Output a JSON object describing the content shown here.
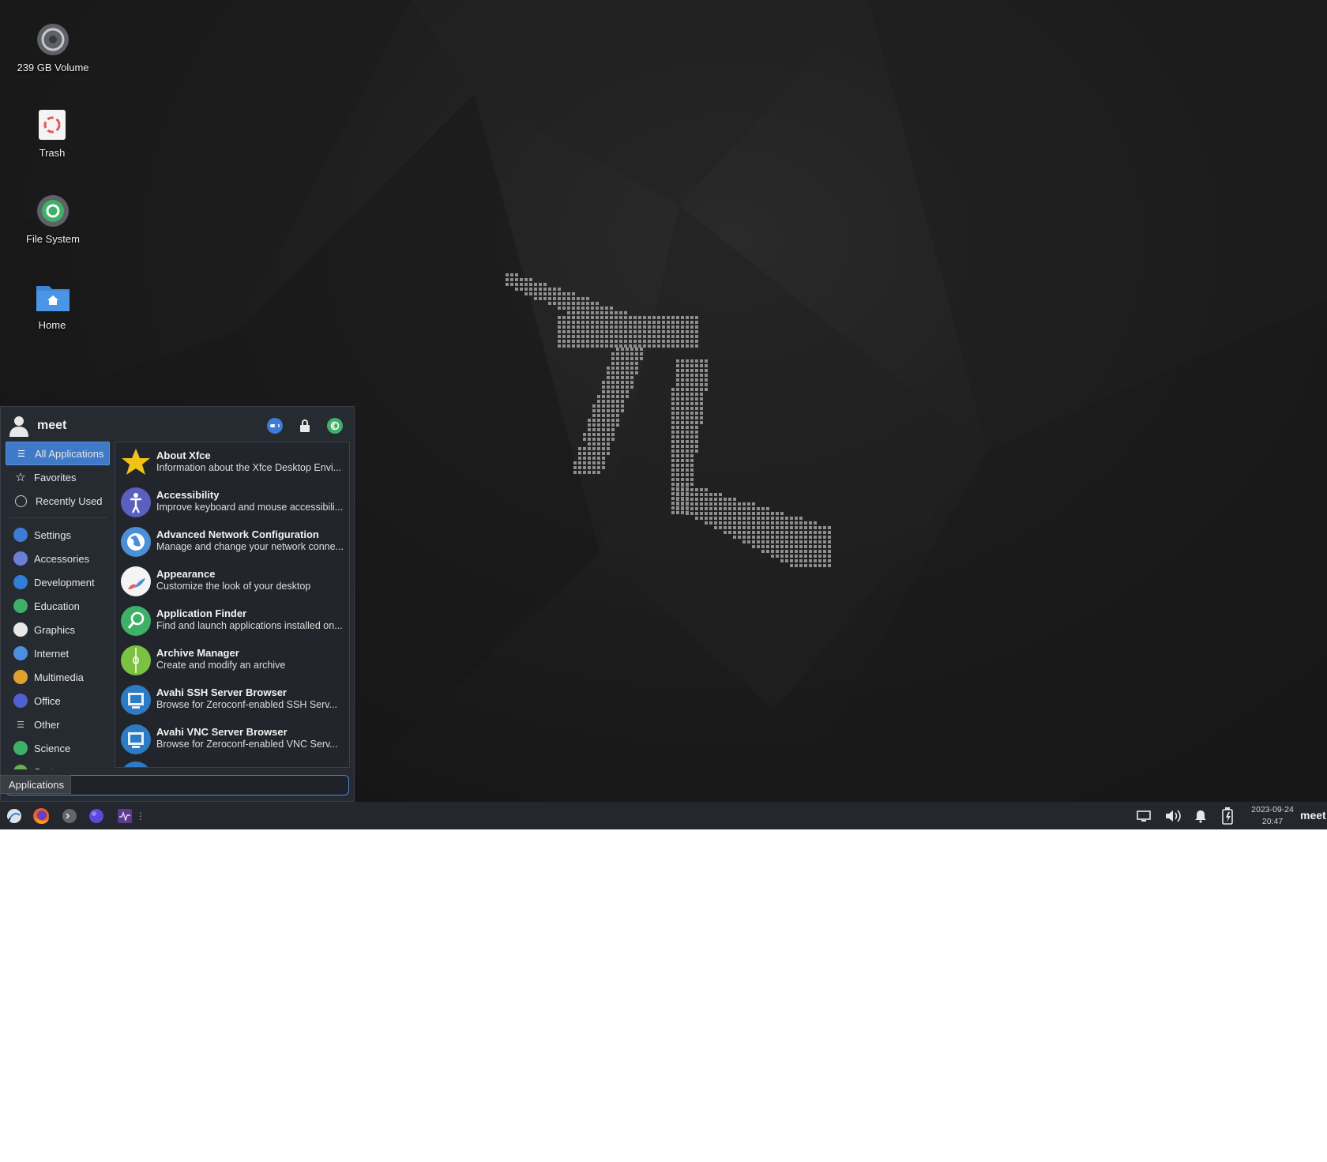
{
  "desktop": {
    "icons": [
      {
        "label": "239 GB Volume",
        "icon": "drive-icon"
      },
      {
        "label": "Trash",
        "icon": "trash-icon"
      },
      {
        "label": "File System",
        "icon": "filesystem-icon"
      },
      {
        "label": "Home",
        "icon": "home-folder-icon"
      }
    ]
  },
  "menu": {
    "user": "meet",
    "header_buttons": [
      "settings-icon",
      "lock-icon",
      "logout-icon"
    ],
    "categories_top": [
      {
        "label": "All Applications",
        "icon": "list-icon",
        "selected": true
      },
      {
        "label": "Favorites",
        "icon": "star-icon"
      },
      {
        "label": "Recently Used",
        "icon": "clock-icon"
      }
    ],
    "categories": [
      {
        "label": "Settings",
        "color": "#3d7bd6"
      },
      {
        "label": "Accessories",
        "color": "#6b7fd6"
      },
      {
        "label": "Development",
        "color": "#2f7fd8"
      },
      {
        "label": "Education",
        "color": "#3fb067"
      },
      {
        "label": "Graphics",
        "color": "#e8e8e8"
      },
      {
        "label": "Internet",
        "color": "#4a8fe0"
      },
      {
        "label": "Multimedia",
        "color": "#e0a030"
      },
      {
        "label": "Office",
        "color": "#5060d0"
      },
      {
        "label": "Other",
        "color": "#888888"
      },
      {
        "label": "Science",
        "color": "#3fb067"
      },
      {
        "label": "System",
        "color": "#6ab04c"
      }
    ],
    "apps": [
      {
        "name": "About Xfce",
        "desc": "Information about the Xfce Desktop Envi...",
        "color": "#f2c316",
        "icon": "xfce-star-icon"
      },
      {
        "name": "Accessibility",
        "desc": "Improve keyboard and mouse accessibili...",
        "color": "#5a5fc0",
        "icon": "accessibility-icon"
      },
      {
        "name": "Advanced Network Configuration",
        "desc": "Manage and change your network conne...",
        "color": "#4a8fd8",
        "icon": "network-globe-icon"
      },
      {
        "name": "Appearance",
        "desc": "Customize the look of your desktop",
        "color": "#f2f2f2",
        "icon": "appearance-icon"
      },
      {
        "name": "Application Finder",
        "desc": "Find and launch applications installed on...",
        "color": "#3fb067",
        "icon": "app-finder-icon"
      },
      {
        "name": "Archive Manager",
        "desc": "Create and modify an archive",
        "color": "#7cc242",
        "icon": "archive-icon"
      },
      {
        "name": "Avahi SSH Server Browser",
        "desc": "Browse for Zeroconf-enabled SSH Serv...",
        "color": "#2d7bc4",
        "icon": "avahi-ssh-icon"
      },
      {
        "name": "Avahi VNC Server Browser",
        "desc": "Browse for Zeroconf-enabled VNC Serv...",
        "color": "#2d7bc4",
        "icon": "avahi-vnc-icon"
      }
    ],
    "search_placeholder": ""
  },
  "tooltip": "Applications",
  "panel": {
    "launchers": [
      "applications-menu-icon",
      "firefox-icon",
      "terminal-icon",
      "purple-app-icon",
      "system-monitor-icon"
    ],
    "clock_date": "2023-09-24",
    "clock_time": "20:47",
    "user": "meet"
  }
}
